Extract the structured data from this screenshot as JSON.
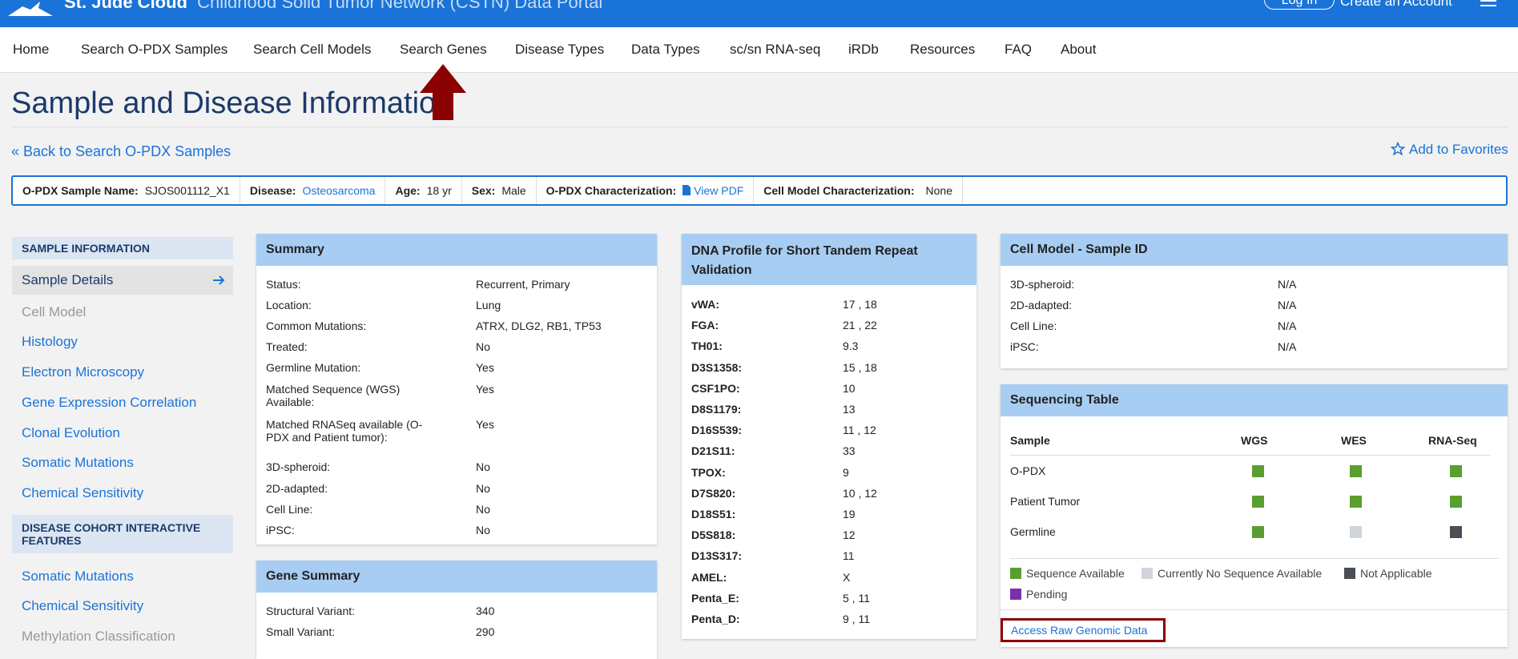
{
  "header": {
    "brand_bold": "St. Jude Cloud",
    "brand_sub": "Childhood Solid Tumor Network (CSTN) Data Portal",
    "login_label": "Log In",
    "create_account_label": "Create an Account"
  },
  "nav": {
    "items": [
      "Home",
      "Search O-PDX Samples",
      "Search Cell Models",
      "Search Genes",
      "Disease Types",
      "Data Types",
      "sc/sn RNA-seq",
      "iRDb",
      "Resources",
      "FAQ",
      "About"
    ]
  },
  "page": {
    "title": "Sample and Disease Information",
    "back_link": "« Back to Search O-PDX Samples",
    "add_favorites": "Add to Favorites"
  },
  "infobar": {
    "sample_label": "O-PDX Sample Name:",
    "sample_value": "SJOS001112_X1",
    "disease_label": "Disease:",
    "disease_value": "Osteosarcoma",
    "age_label": "Age:",
    "age_value": "18 yr",
    "sex_label": "Sex:",
    "sex_value": "Male",
    "opdx_char_label": "O-PDX Characterization:",
    "opdx_char_value": "View PDF",
    "cell_char_label": "Cell Model Characterization:",
    "cell_char_value": "None"
  },
  "sidebar": {
    "section1": "SAMPLE INFORMATION",
    "active": "Sample Details",
    "items1": [
      "Cell Model",
      "Histology",
      "Electron Microscopy",
      "Gene Expression Correlation",
      "Clonal Evolution",
      "Somatic Mutations",
      "Chemical Sensitivity"
    ],
    "section2": "DISEASE COHORT INTERACTIVE FEATURES",
    "items2": [
      "Somatic Mutations",
      "Chemical Sensitivity",
      "Methylation Classification"
    ]
  },
  "summary": {
    "title": "Summary",
    "rows": [
      {
        "k": "Status:",
        "v": "Recurrent, Primary"
      },
      {
        "k": "Location:",
        "v": "Lung"
      },
      {
        "k": "Common Mutations:",
        "v": "ATRX, DLG2, RB1, TP53"
      },
      {
        "k": "Treated:",
        "v": "No"
      },
      {
        "k": "Germline Mutation:",
        "v": "Yes"
      },
      {
        "k": "Matched Sequence (WGS) Available:",
        "v": "Yes"
      },
      {
        "k": "Matched RNASeq available (O-PDX and Patient tumor):",
        "v": "Yes"
      },
      {
        "k": "3D-spheroid:",
        "v": "No"
      },
      {
        "k": "2D-adapted:",
        "v": "No"
      },
      {
        "k": "Cell Line:",
        "v": "No"
      },
      {
        "k": "iPSC:",
        "v": "No"
      }
    ]
  },
  "gene_summary": {
    "title": "Gene Summary",
    "rows": [
      {
        "k": "Structural Variant:",
        "v": "340"
      },
      {
        "k": "Small Variant:",
        "v": "290"
      }
    ]
  },
  "dna_profile": {
    "title": "DNA Profile for Short Tandem Repeat Validation",
    "rows": [
      {
        "k": "vWA:",
        "v": "17 , 18"
      },
      {
        "k": "FGA:",
        "v": "21 , 22"
      },
      {
        "k": "TH01:",
        "v": "9.3"
      },
      {
        "k": "D3S1358:",
        "v": "15 , 18"
      },
      {
        "k": "CSF1PO:",
        "v": "10"
      },
      {
        "k": "D8S1179:",
        "v": "13"
      },
      {
        "k": "D16S539:",
        "v": "11 , 12"
      },
      {
        "k": "D21S11:",
        "v": "33"
      },
      {
        "k": "TPOX:",
        "v": "9"
      },
      {
        "k": "D7S820:",
        "v": "10 , 12"
      },
      {
        "k": "D18S51:",
        "v": "19"
      },
      {
        "k": "D5S818:",
        "v": "12"
      },
      {
        "k": "D13S317:",
        "v": "11"
      },
      {
        "k": "AMEL:",
        "v": "X"
      },
      {
        "k": "Penta_E:",
        "v": "5 , 11"
      },
      {
        "k": "Penta_D:",
        "v": "9 , 11"
      }
    ]
  },
  "cell_model": {
    "title": "Cell Model - Sample ID",
    "rows": [
      {
        "k": "3D-spheroid:",
        "v": "N/A"
      },
      {
        "k": "2D-adapted:",
        "v": "N/A"
      },
      {
        "k": "Cell Line:",
        "v": "N/A"
      },
      {
        "k": "iPSC:",
        "v": "N/A"
      }
    ]
  },
  "sequencing": {
    "title": "Sequencing Table",
    "headers": [
      "Sample",
      "WGS",
      "WES",
      "RNA-Seq"
    ],
    "rows": [
      {
        "sample": "O-PDX",
        "status": [
          "available",
          "available",
          "available"
        ]
      },
      {
        "sample": "Patient Tumor",
        "status": [
          "available",
          "available",
          "available"
        ]
      },
      {
        "sample": "Germline",
        "status": [
          "available",
          "none",
          "na"
        ]
      }
    ],
    "legend": {
      "available": "Sequence Available",
      "none": "Currently No Sequence Available",
      "na": "Not Applicable",
      "pending": "Pending"
    },
    "colors": {
      "available": "#5a9e2f",
      "none": "#d0d5db",
      "na": "#4a4f55",
      "pending": "#7b2fa8"
    },
    "raw_link": "Access Raw Genomic Data"
  },
  "colors": {
    "brand": "#1a73d8",
    "card_header": "#a8cdf2",
    "annotation": "#8b0000"
  }
}
